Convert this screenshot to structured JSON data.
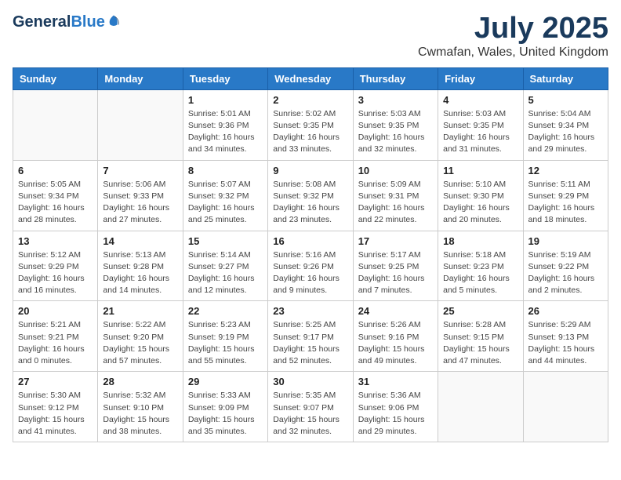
{
  "logo": {
    "general": "General",
    "blue": "Blue"
  },
  "header": {
    "month": "July 2025",
    "location": "Cwmafan, Wales, United Kingdom"
  },
  "weekdays": [
    "Sunday",
    "Monday",
    "Tuesday",
    "Wednesday",
    "Thursday",
    "Friday",
    "Saturday"
  ],
  "weeks": [
    [
      {
        "day": "",
        "info": ""
      },
      {
        "day": "",
        "info": ""
      },
      {
        "day": "1",
        "info": "Sunrise: 5:01 AM\nSunset: 9:36 PM\nDaylight: 16 hours and 34 minutes."
      },
      {
        "day": "2",
        "info": "Sunrise: 5:02 AM\nSunset: 9:35 PM\nDaylight: 16 hours and 33 minutes."
      },
      {
        "day": "3",
        "info": "Sunrise: 5:03 AM\nSunset: 9:35 PM\nDaylight: 16 hours and 32 minutes."
      },
      {
        "day": "4",
        "info": "Sunrise: 5:03 AM\nSunset: 9:35 PM\nDaylight: 16 hours and 31 minutes."
      },
      {
        "day": "5",
        "info": "Sunrise: 5:04 AM\nSunset: 9:34 PM\nDaylight: 16 hours and 29 minutes."
      }
    ],
    [
      {
        "day": "6",
        "info": "Sunrise: 5:05 AM\nSunset: 9:34 PM\nDaylight: 16 hours and 28 minutes."
      },
      {
        "day": "7",
        "info": "Sunrise: 5:06 AM\nSunset: 9:33 PM\nDaylight: 16 hours and 27 minutes."
      },
      {
        "day": "8",
        "info": "Sunrise: 5:07 AM\nSunset: 9:32 PM\nDaylight: 16 hours and 25 minutes."
      },
      {
        "day": "9",
        "info": "Sunrise: 5:08 AM\nSunset: 9:32 PM\nDaylight: 16 hours and 23 minutes."
      },
      {
        "day": "10",
        "info": "Sunrise: 5:09 AM\nSunset: 9:31 PM\nDaylight: 16 hours and 22 minutes."
      },
      {
        "day": "11",
        "info": "Sunrise: 5:10 AM\nSunset: 9:30 PM\nDaylight: 16 hours and 20 minutes."
      },
      {
        "day": "12",
        "info": "Sunrise: 5:11 AM\nSunset: 9:29 PM\nDaylight: 16 hours and 18 minutes."
      }
    ],
    [
      {
        "day": "13",
        "info": "Sunrise: 5:12 AM\nSunset: 9:29 PM\nDaylight: 16 hours and 16 minutes."
      },
      {
        "day": "14",
        "info": "Sunrise: 5:13 AM\nSunset: 9:28 PM\nDaylight: 16 hours and 14 minutes."
      },
      {
        "day": "15",
        "info": "Sunrise: 5:14 AM\nSunset: 9:27 PM\nDaylight: 16 hours and 12 minutes."
      },
      {
        "day": "16",
        "info": "Sunrise: 5:16 AM\nSunset: 9:26 PM\nDaylight: 16 hours and 9 minutes."
      },
      {
        "day": "17",
        "info": "Sunrise: 5:17 AM\nSunset: 9:25 PM\nDaylight: 16 hours and 7 minutes."
      },
      {
        "day": "18",
        "info": "Sunrise: 5:18 AM\nSunset: 9:23 PM\nDaylight: 16 hours and 5 minutes."
      },
      {
        "day": "19",
        "info": "Sunrise: 5:19 AM\nSunset: 9:22 PM\nDaylight: 16 hours and 2 minutes."
      }
    ],
    [
      {
        "day": "20",
        "info": "Sunrise: 5:21 AM\nSunset: 9:21 PM\nDaylight: 16 hours and 0 minutes."
      },
      {
        "day": "21",
        "info": "Sunrise: 5:22 AM\nSunset: 9:20 PM\nDaylight: 15 hours and 57 minutes."
      },
      {
        "day": "22",
        "info": "Sunrise: 5:23 AM\nSunset: 9:19 PM\nDaylight: 15 hours and 55 minutes."
      },
      {
        "day": "23",
        "info": "Sunrise: 5:25 AM\nSunset: 9:17 PM\nDaylight: 15 hours and 52 minutes."
      },
      {
        "day": "24",
        "info": "Sunrise: 5:26 AM\nSunset: 9:16 PM\nDaylight: 15 hours and 49 minutes."
      },
      {
        "day": "25",
        "info": "Sunrise: 5:28 AM\nSunset: 9:15 PM\nDaylight: 15 hours and 47 minutes."
      },
      {
        "day": "26",
        "info": "Sunrise: 5:29 AM\nSunset: 9:13 PM\nDaylight: 15 hours and 44 minutes."
      }
    ],
    [
      {
        "day": "27",
        "info": "Sunrise: 5:30 AM\nSunset: 9:12 PM\nDaylight: 15 hours and 41 minutes."
      },
      {
        "day": "28",
        "info": "Sunrise: 5:32 AM\nSunset: 9:10 PM\nDaylight: 15 hours and 38 minutes."
      },
      {
        "day": "29",
        "info": "Sunrise: 5:33 AM\nSunset: 9:09 PM\nDaylight: 15 hours and 35 minutes."
      },
      {
        "day": "30",
        "info": "Sunrise: 5:35 AM\nSunset: 9:07 PM\nDaylight: 15 hours and 32 minutes."
      },
      {
        "day": "31",
        "info": "Sunrise: 5:36 AM\nSunset: 9:06 PM\nDaylight: 15 hours and 29 minutes."
      },
      {
        "day": "",
        "info": ""
      },
      {
        "day": "",
        "info": ""
      }
    ]
  ]
}
